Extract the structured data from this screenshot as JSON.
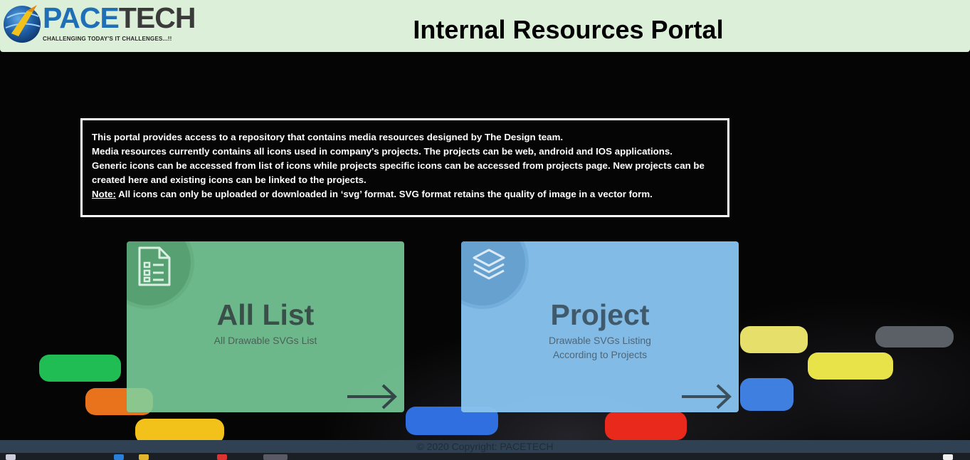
{
  "header": {
    "logo": {
      "word_pace": "PACE",
      "word_tech": "TECH",
      "tagline": "CHALLENGING TODAY'S IT CHALLENGES...!!"
    },
    "title": "Internal Resources Portal"
  },
  "info": {
    "lines": [
      "This portal provides access to a repository that contains media resources designed by The Design team.",
      "Media resources currently contains all icons used in company's projects. The projects can be web, android and IOS applications.",
      "Generic icons can be accessed from list of icons while projects specific icons can be accessed from projects page. New projects can be created here and existing icons can be linked to the projects."
    ],
    "note_label": "Note:",
    "note_text": " All icons can only be uploaded or downloaded in ‘svg’ format. SVG format retains the quality of image in a vector form."
  },
  "cards": [
    {
      "title": "All List",
      "subtitle": "All Drawable SVGs List",
      "icon": "document-list-icon",
      "color": "#7cd29e"
    },
    {
      "title": "Project",
      "subtitle_line1": "Drawable SVGs Listing",
      "subtitle_line2": "According to Projects",
      "icon": "layers-icon",
      "color": "#87c3ee"
    }
  ],
  "footer": {
    "copyright": "© 2020 Copyright: PACETECH"
  },
  "colors": {
    "header_bg": "#dcefd8",
    "footer_bg": "#2f4152"
  }
}
